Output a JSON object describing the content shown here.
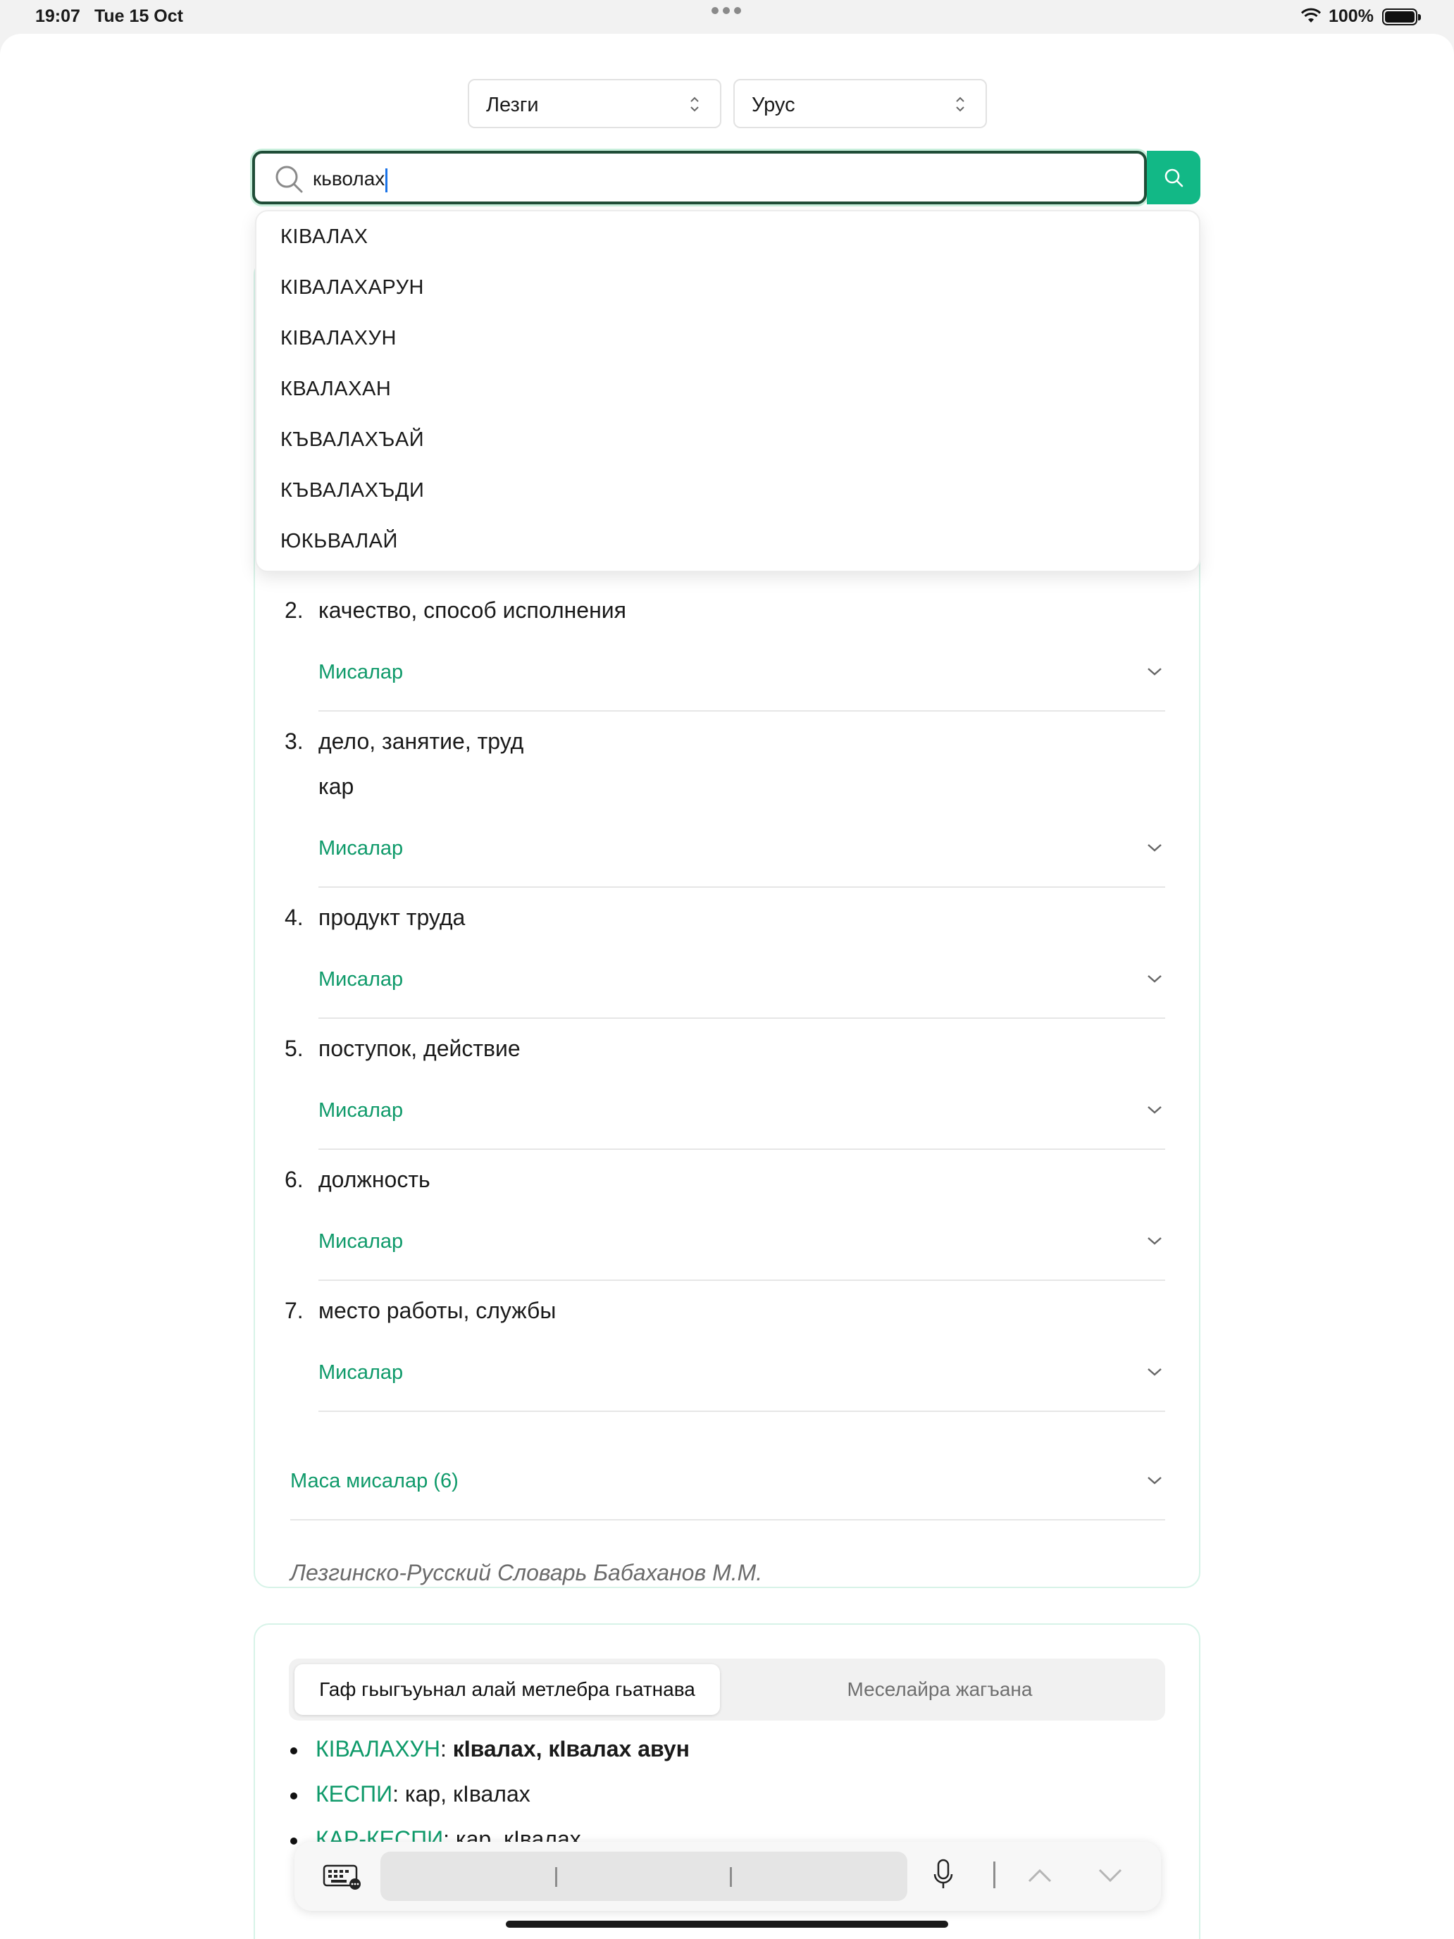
{
  "status_bar": {
    "time": "19:07",
    "date": "Tue 15 Oct",
    "battery": "100%"
  },
  "language_selectors": {
    "source": "Лезги",
    "target": "Урус"
  },
  "search": {
    "value": "кьволах"
  },
  "suggestions": [
    "КIВАЛАХ",
    "КIВАЛАХАРУН",
    "КIВАЛАХУН",
    "КВАЛАХАН",
    "КЪВАЛАХЪАЙ",
    "КЪВАЛАХЪДИ",
    "ЮКЬВАЛАЙ"
  ],
  "entry": {
    "senses": [
      {
        "num": "2.",
        "text": "качество, способ исполнения",
        "examples": "Мисалар"
      },
      {
        "num": "3.",
        "text": "дело, занятие, труд",
        "sub": "кар",
        "examples": "Мисалар"
      },
      {
        "num": "4.",
        "text": "продукт труда",
        "examples": "Мисалар"
      },
      {
        "num": "5.",
        "text": "поступок, действие",
        "examples": "Мисалар"
      },
      {
        "num": "6.",
        "text": "должность",
        "examples": "Мисалар"
      },
      {
        "num": "7.",
        "text": "место работы, службы",
        "examples": "Мисалар"
      }
    ],
    "mass_examples": "Маса мисалар (6)",
    "source": "Лезгинско-Русский Словарь Бабаханов М.М."
  },
  "related": {
    "tabs": [
      "Гаф гьыгъуьнал алай метлебра гьатнава",
      "Меселайра жагъана"
    ],
    "items": [
      {
        "word": "КIВАЛАХУН",
        "sep": ": ",
        "def": "кIвалах, кIвалах авун"
      },
      {
        "word": "КЕСПИ",
        "sep": ": ",
        "def": "кар, кIвалах"
      },
      {
        "word": "КАР-КЕСПИ",
        "sep": ": ",
        "def": "кар, кIвалах"
      }
    ]
  },
  "colors": {
    "accent": "#12b886",
    "link": "#0f9a6a",
    "focus_border": "#1f4d37"
  }
}
